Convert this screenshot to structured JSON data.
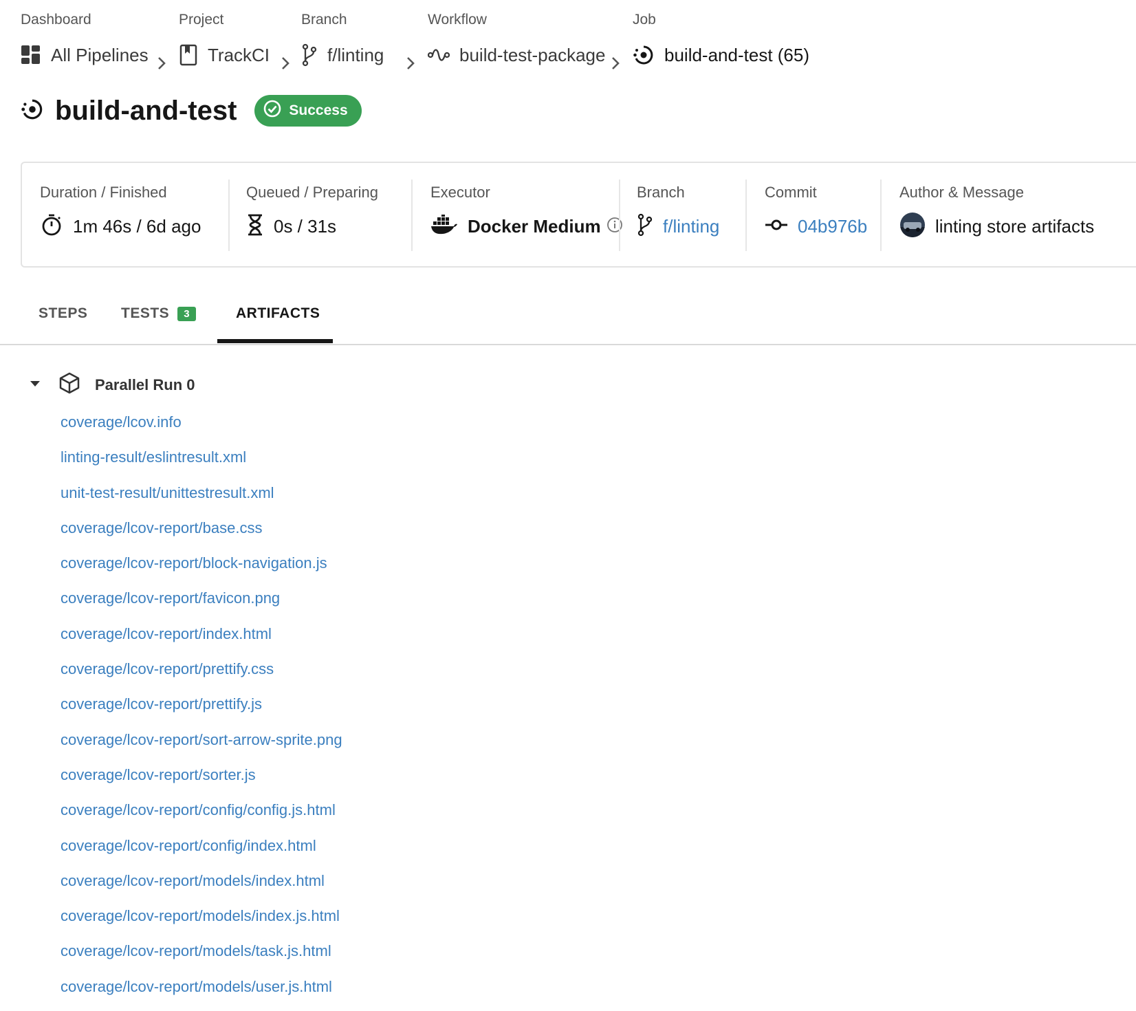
{
  "breadcrumb": [
    {
      "label": "Dashboard",
      "value": "All Pipelines",
      "icon": "dashboard-icon"
    },
    {
      "label": "Project",
      "value": "TrackCI",
      "icon": "bookmark-icon"
    },
    {
      "label": "Branch",
      "value": "f/linting",
      "icon": "branch-icon"
    },
    {
      "label": "Workflow",
      "value": "build-test-package",
      "icon": "workflow-icon"
    },
    {
      "label": "Job",
      "value": "build-and-test (65)",
      "icon": "job-icon"
    }
  ],
  "job": {
    "title": "build-and-test",
    "status": "Success",
    "status_color": "#39a054"
  },
  "info": {
    "duration": {
      "label": "Duration / Finished",
      "value": "1m 46s / 6d ago",
      "icon": "stopwatch-icon"
    },
    "queued": {
      "label": "Queued / Preparing",
      "value": "0s / 31s",
      "icon": "hourglass-icon"
    },
    "executor": {
      "label": "Executor",
      "value": "Docker Medium",
      "icon": "docker-icon"
    },
    "branch": {
      "label": "Branch",
      "value": "f/linting",
      "icon": "branch-icon"
    },
    "commit": {
      "label": "Commit",
      "value": "04b976b",
      "icon": "commit-icon"
    },
    "author": {
      "label": "Author & Message",
      "value": "linting store artifacts",
      "icon": "avatar"
    }
  },
  "tabs": [
    {
      "label": "STEPS",
      "active": false
    },
    {
      "label": "TESTS",
      "count": "3",
      "active": false
    },
    {
      "label": "ARTIFACTS",
      "active": true
    }
  ],
  "artifacts": {
    "group": "Parallel Run 0",
    "files": [
      "coverage/lcov.info",
      "linting-result/eslintresult.xml",
      "unit-test-result/unittestresult.xml",
      "coverage/lcov-report/base.css",
      "coverage/lcov-report/block-navigation.js",
      "coverage/lcov-report/favicon.png",
      "coverage/lcov-report/index.html",
      "coverage/lcov-report/prettify.css",
      "coverage/lcov-report/prettify.js",
      "coverage/lcov-report/sort-arrow-sprite.png",
      "coverage/lcov-report/sorter.js",
      "coverage/lcov-report/config/config.js.html",
      "coverage/lcov-report/config/index.html",
      "coverage/lcov-report/models/index.html",
      "coverage/lcov-report/models/index.js.html",
      "coverage/lcov-report/models/task.js.html",
      "coverage/lcov-report/models/user.js.html"
    ]
  },
  "colors": {
    "link": "#3b7fbf",
    "success": "#39a054",
    "text": "#161616"
  }
}
